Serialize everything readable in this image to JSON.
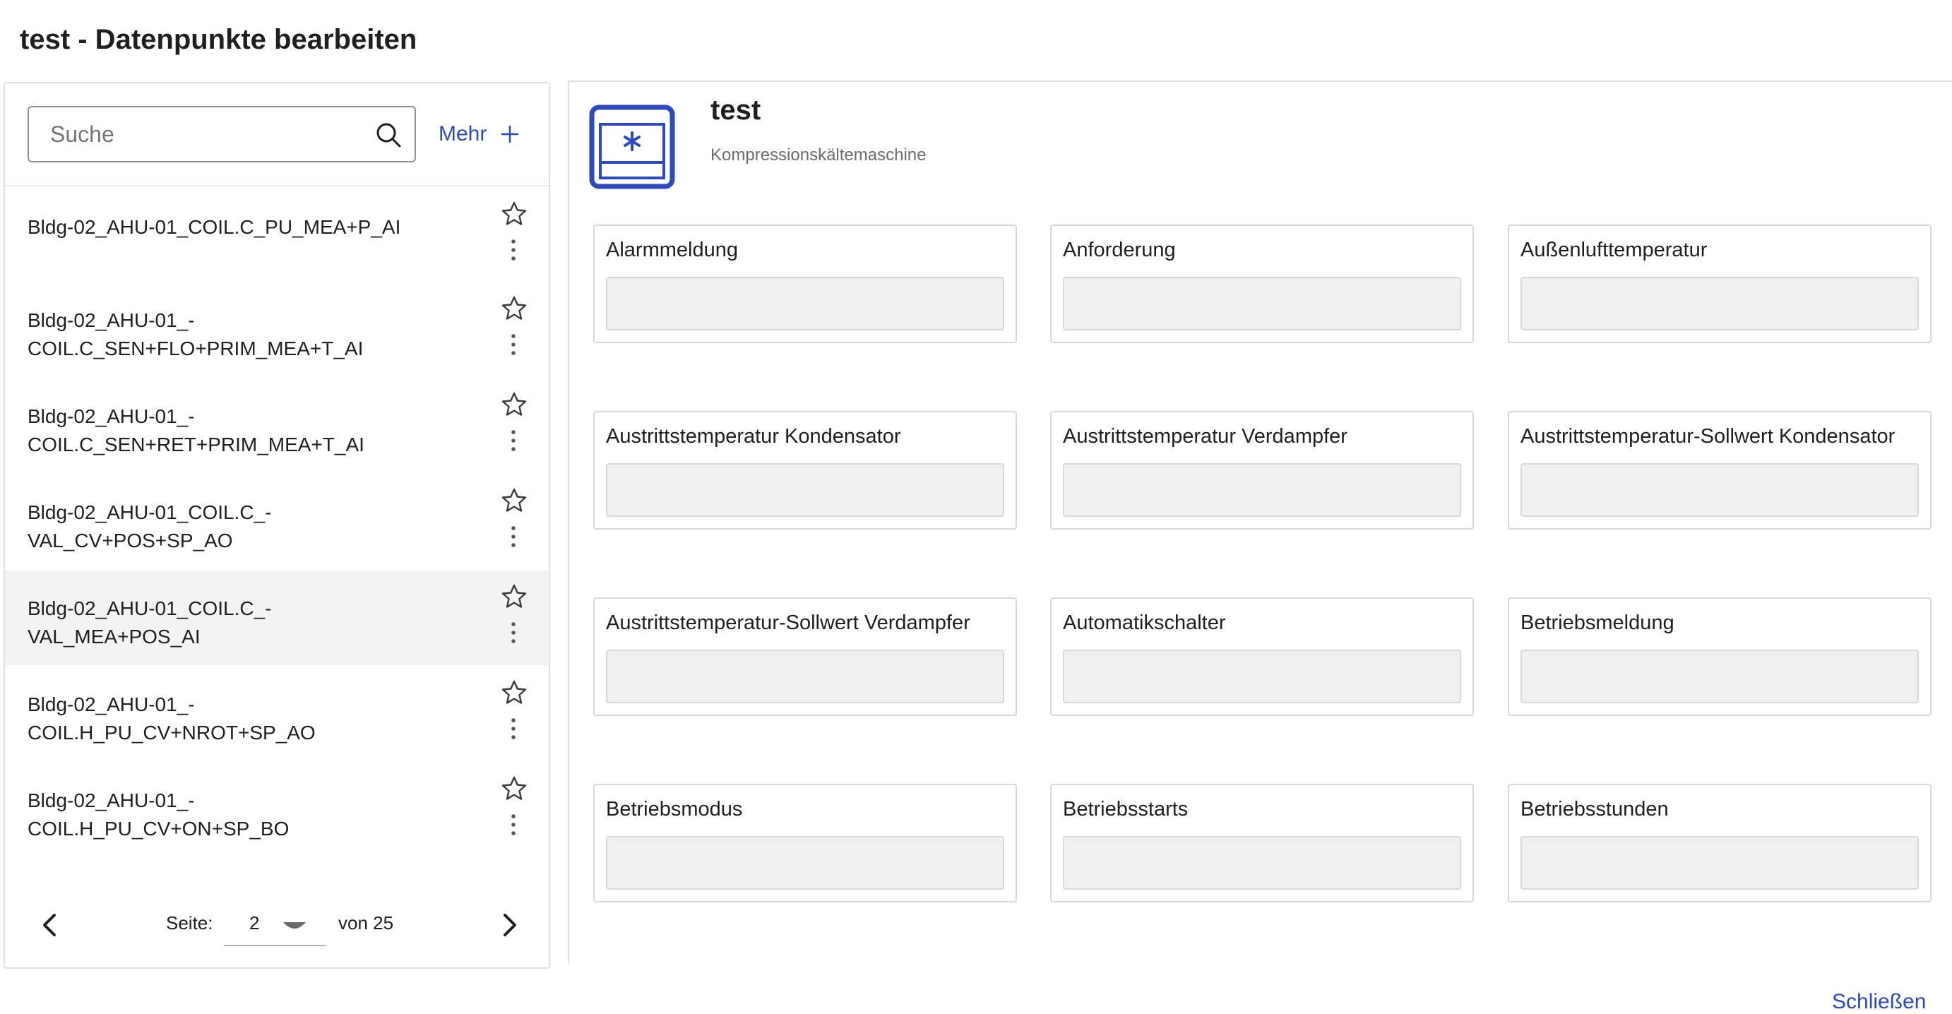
{
  "window": {
    "title": "test - Datenpunkte bearbeiten"
  },
  "search": {
    "placeholder": "Suche",
    "value": ""
  },
  "more": {
    "label": "Mehr"
  },
  "list": {
    "items": [
      {
        "label": "Bldg-02_AHU-01_COIL.C_PU_MEA+P_AI",
        "selected": false
      },
      {
        "label": "Bldg-02_AHU-01_-\nCOIL.C_SEN+FLO+PRIM_MEA+T_AI",
        "selected": false
      },
      {
        "label": "Bldg-02_AHU-01_-\nCOIL.C_SEN+RET+PRIM_MEA+T_AI",
        "selected": false
      },
      {
        "label": "Bldg-02_AHU-01_COIL.C_-\nVAL_CV+POS+SP_AO",
        "selected": false
      },
      {
        "label": "Bldg-02_AHU-01_COIL.C_-\nVAL_MEA+POS_AI",
        "selected": true
      },
      {
        "label": "Bldg-02_AHU-01_-\nCOIL.H_PU_CV+NROT+SP_AO",
        "selected": false
      },
      {
        "label": "Bldg-02_AHU-01_-\nCOIL.H_PU_CV+ON+SP_BO",
        "selected": false
      }
    ]
  },
  "pager": {
    "label": "Seite:",
    "page": "2",
    "of": "von 25"
  },
  "device": {
    "name": "test",
    "type": "Kompressionskältemaschine",
    "icon": "chiller-icon"
  },
  "datapoints": [
    {
      "label": "Alarmmeldung",
      "value": ""
    },
    {
      "label": "Anforderung",
      "value": ""
    },
    {
      "label": "Außenlufttemperatur",
      "value": ""
    },
    {
      "label": "Austrittstemperatur Kondensator",
      "value": ""
    },
    {
      "label": "Austrittstemperatur Verdampfer",
      "value": ""
    },
    {
      "label": "Austrittstemperatur-Sollwert Kondensator",
      "value": ""
    },
    {
      "label": "Austrittstemperatur-Sollwert Verdampfer",
      "value": ""
    },
    {
      "label": "Automatikschalter",
      "value": ""
    },
    {
      "label": "Betriebsmeldung",
      "value": ""
    },
    {
      "label": "Betriebsmodus",
      "value": ""
    },
    {
      "label": "Betriebsstarts",
      "value": ""
    },
    {
      "label": "Betriebsstunden",
      "value": ""
    }
  ],
  "footer": {
    "close_label": "Schließen"
  },
  "colors": {
    "accent": "#2d4ac0",
    "border": "#d9d9dc",
    "field_bg": "#f0f0f1",
    "selected_bg": "#f3f3f4"
  }
}
